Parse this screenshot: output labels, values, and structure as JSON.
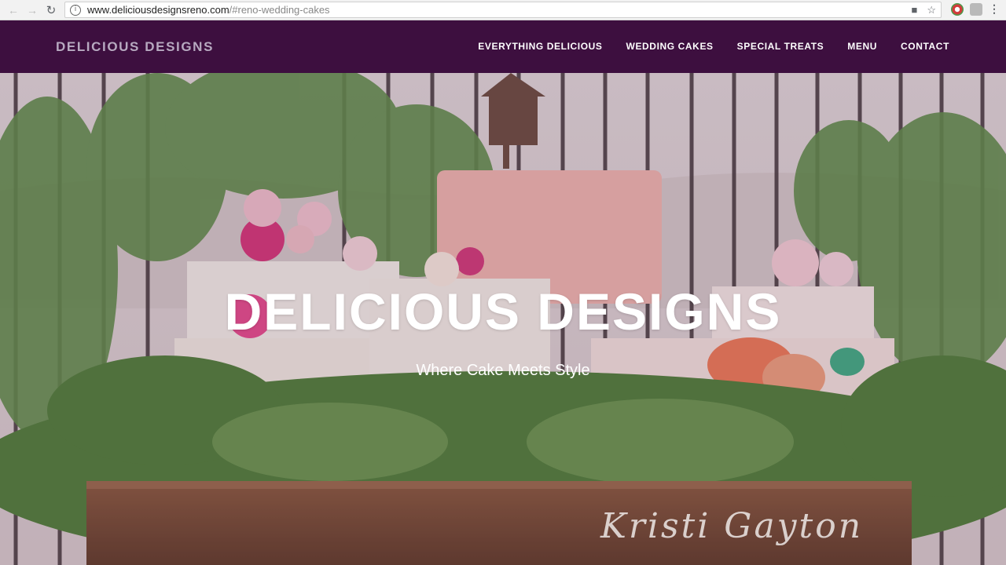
{
  "browser": {
    "url_domain": "www.deliciousdesignsreno.com",
    "url_path": "/#reno-wedding-cakes"
  },
  "header": {
    "logo_text": "DELICIOUS DESIGNS",
    "nav": [
      {
        "label": "EVERYTHING DELICIOUS"
      },
      {
        "label": "WEDDING CAKES"
      },
      {
        "label": "SPECIAL TREATS"
      },
      {
        "label": "MENU"
      },
      {
        "label": "CONTACT"
      }
    ],
    "background_color": "#3d0f3f"
  },
  "hero": {
    "title": "DELICIOUS DESIGNS",
    "subtitle": "Where Cake Meets Style",
    "signature": "Kristi Gayton"
  }
}
